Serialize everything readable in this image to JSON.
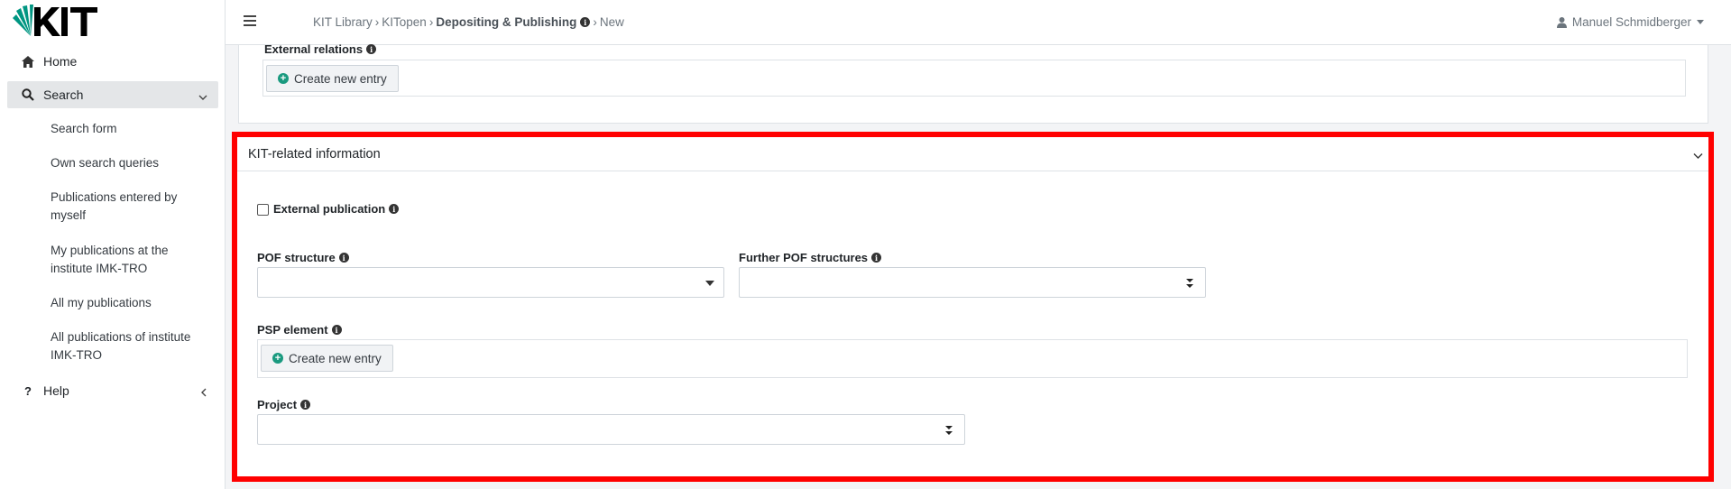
{
  "sidebar": {
    "home_label": "Home",
    "search_label": "Search",
    "search_items": [
      "Search form",
      "Own search queries",
      "Publications entered by myself",
      "My publications at the institute IMK-TRO",
      "All my publications",
      "All publications of institute IMK-TRO"
    ],
    "help_label": "Help"
  },
  "topbar": {
    "breadcrumb": [
      "KIT Library",
      "KITopen",
      "Depositing & Publishing",
      "New"
    ],
    "user_name": "Manuel Schmidberger"
  },
  "external_relations": {
    "label": "External relations",
    "create_button": "Create new entry"
  },
  "kit_section": {
    "title": "KIT-related information",
    "external_publication_label": "External publication",
    "external_publication_checked": false,
    "pof_structure_label": "POF structure",
    "pof_structure_value": "",
    "further_pof_label": "Further POF structures",
    "further_pof_value": "",
    "psp_element_label": "PSP element",
    "psp_create_button": "Create new entry",
    "project_label": "Project",
    "project_value": ""
  },
  "colors": {
    "highlight_border": "#ff0000",
    "accent_green": "#1a9a7f"
  }
}
